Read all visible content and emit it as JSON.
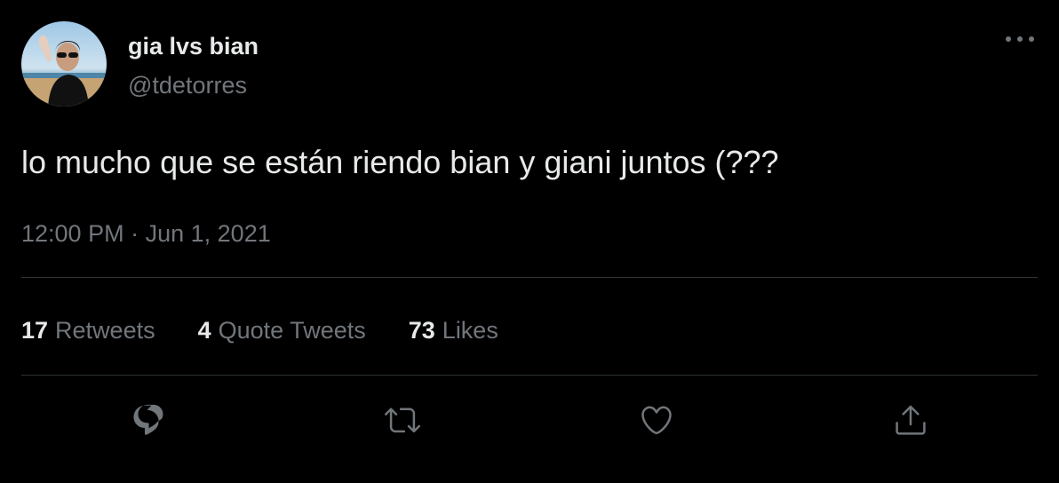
{
  "author": {
    "display_name": "gia lvs bian",
    "handle": "@tdetorres"
  },
  "tweet": {
    "text": "lo mucho que se están riendo bian y giani juntos (???",
    "time": "12:00 PM",
    "separator": "·",
    "date": "Jun 1, 2021"
  },
  "stats": {
    "retweets": {
      "count": "17",
      "label": "Retweets"
    },
    "quotes": {
      "count": "4",
      "label": "Quote Tweets"
    },
    "likes": {
      "count": "73",
      "label": "Likes"
    }
  },
  "icons": {
    "more": "more-horizontal-icon",
    "reply": "reply-icon",
    "retweet": "retweet-icon",
    "like": "heart-icon",
    "share": "share-icon"
  },
  "colors": {
    "background": "#000000",
    "primary_text": "#e7e9ea",
    "secondary_text": "#71767b",
    "divider": "#2f3336"
  }
}
